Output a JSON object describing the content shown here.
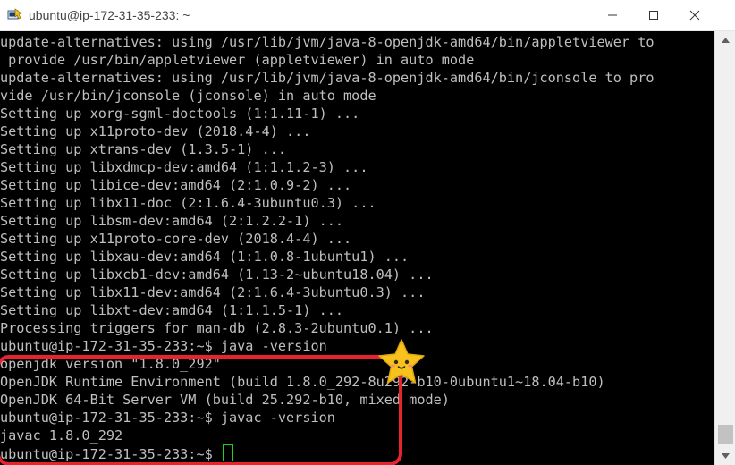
{
  "window": {
    "title": "ubuntu@ip-172-31-35-233: ~",
    "icon": "putty-icon"
  },
  "terminal": {
    "lines": [
      "update-alternatives: using /usr/lib/jvm/java-8-openjdk-amd64/bin/appletviewer to",
      " provide /usr/bin/appletviewer (appletviewer) in auto mode",
      "update-alternatives: using /usr/lib/jvm/java-8-openjdk-amd64/bin/jconsole to pro",
      "vide /usr/bin/jconsole (jconsole) in auto mode",
      "Setting up xorg-sgml-doctools (1:1.11-1) ...",
      "Setting up x11proto-dev (2018.4-4) ...",
      "Setting up xtrans-dev (1.3.5-1) ...",
      "Setting up libxdmcp-dev:amd64 (1:1.1.2-3) ...",
      "Setting up libice-dev:amd64 (2:1.0.9-2) ...",
      "Setting up libx11-doc (2:1.6.4-3ubuntu0.3) ...",
      "Setting up libsm-dev:amd64 (2:1.2.2-1) ...",
      "Setting up x11proto-core-dev (2018.4-4) ...",
      "Setting up libxau-dev:amd64 (1:1.0.8-1ubuntu1) ...",
      "Setting up libxcb1-dev:amd64 (1.13-2~ubuntu18.04) ...",
      "Setting up libx11-dev:amd64 (2:1.6.4-3ubuntu0.3) ...",
      "Setting up libxt-dev:amd64 (1:1.1.5-1) ...",
      "Processing triggers for man-db (2.8.3-2ubuntu0.1) ...",
      "ubuntu@ip-172-31-35-233:~$ java -version",
      "openjdk version \"1.8.0_292\"",
      "OpenJDK Runtime Environment (build 1.8.0_292-8u292-b10-0ubuntu1~18.04-b10)",
      "OpenJDK 64-Bit Server VM (build 25.292-b10, mixed mode)",
      "ubuntu@ip-172-31-35-233:~$ javac -version",
      "javac 1.8.0_292"
    ],
    "prompt": "ubuntu@ip-172-31-35-233:~$ "
  },
  "colors": {
    "background": "#000000",
    "text": "#bfbfbf",
    "cursor": "#1fd11f",
    "highlight": "#e8232d",
    "star": "#f7c21d"
  }
}
